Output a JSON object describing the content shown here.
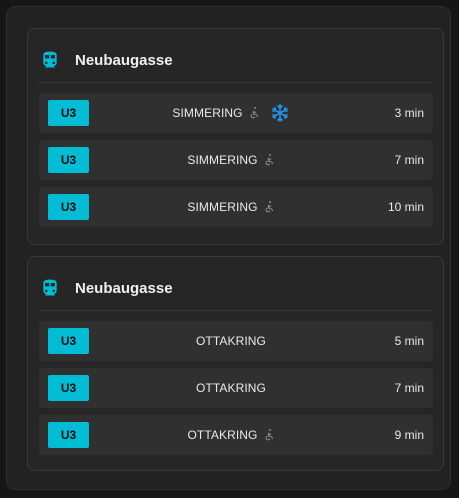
{
  "colors": {
    "accent": "#00bcd4",
    "background": "#161616",
    "card": "#262626",
    "row": "#303030"
  },
  "stations": [
    {
      "name": "Neubaugasse",
      "icon": "subway-icon",
      "departures": [
        {
          "line": "U3",
          "destination": "SIMMERING",
          "wheelchair": true,
          "air_conditioned": true,
          "time": "3 min"
        },
        {
          "line": "U3",
          "destination": "SIMMERING",
          "wheelchair": true,
          "air_conditioned": false,
          "time": "7 min"
        },
        {
          "line": "U3",
          "destination": "SIMMERING",
          "wheelchair": true,
          "air_conditioned": false,
          "time": "10 min"
        }
      ]
    },
    {
      "name": "Neubaugasse",
      "icon": "subway-icon",
      "departures": [
        {
          "line": "U3",
          "destination": "OTTAKRING",
          "wheelchair": false,
          "air_conditioned": false,
          "time": "5 min"
        },
        {
          "line": "U3",
          "destination": "OTTAKRING",
          "wheelchair": false,
          "air_conditioned": false,
          "time": "7 min"
        },
        {
          "line": "U3",
          "destination": "OTTAKRING",
          "wheelchair": true,
          "air_conditioned": false,
          "time": "9 min"
        }
      ]
    }
  ]
}
